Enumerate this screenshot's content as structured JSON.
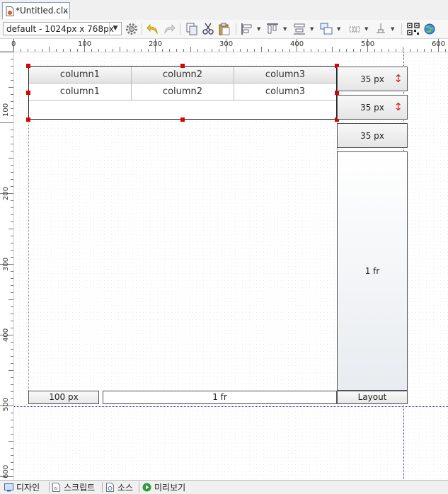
{
  "tab": {
    "title": "*Untitled.clx",
    "close": "×"
  },
  "toolbar": {
    "screen_select": "default - 1024px x 768px",
    "icons": [
      "settings-icon",
      "undo-icon",
      "redo-icon",
      "copy-icon",
      "cut-icon",
      "paste-icon",
      "align-left-icon",
      "align-top-icon",
      "distribute-icon",
      "group-icon",
      "grid-layout-icon",
      "anchor-icon",
      "qr-code-icon",
      "globe-icon"
    ]
  },
  "ruler": {
    "top": [
      "0",
      "100",
      "200",
      "300",
      "400",
      "500",
      "600"
    ],
    "left": [
      "100",
      "200",
      "300",
      "400",
      "500",
      "600"
    ]
  },
  "grid": {
    "header": [
      "column1",
      "column2",
      "column3"
    ],
    "row": [
      "column1",
      "column2",
      "column3"
    ]
  },
  "layout": {
    "rows": [
      {
        "label": "35 px",
        "resize": true
      },
      {
        "label": "35 px",
        "resize": true
      },
      {
        "label": "35 px",
        "resize": false
      },
      {
        "label": "1 fr",
        "resize": false
      }
    ],
    "columns": [
      "100 px",
      "1 fr"
    ],
    "corner_label": "Layout",
    "resize_icon": "↕"
  },
  "bottom_tabs": [
    {
      "label": "디자인",
      "icon": "design-view-icon"
    },
    {
      "label": "스크립트",
      "icon": "script-js-icon"
    },
    {
      "label": "소스",
      "icon": "source-file-icon"
    },
    {
      "label": "미리보기",
      "icon": "preview-play-icon"
    }
  ]
}
